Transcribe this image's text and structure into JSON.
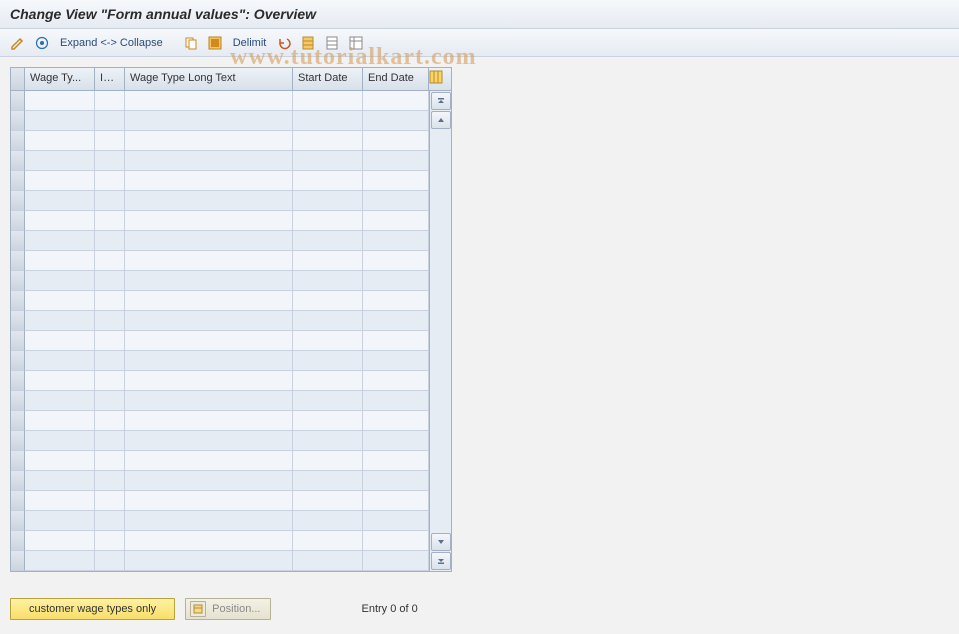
{
  "title": "Change View \"Form annual values\": Overview",
  "toolbar": {
    "expand_collapse": "Expand <-> Collapse",
    "delimit": "Delimit"
  },
  "columns": {
    "wage_type": "Wage Ty...",
    "inf": "Inf...",
    "long_text": "Wage Type Long Text",
    "start_date": "Start Date",
    "end_date": "End Date"
  },
  "rows": [
    {},
    {},
    {},
    {},
    {},
    {},
    {},
    {},
    {},
    {},
    {},
    {},
    {},
    {},
    {},
    {},
    {},
    {},
    {},
    {},
    {},
    {},
    {},
    {}
  ],
  "footer": {
    "customer_btn": "customer wage types only",
    "position_btn": "Position...",
    "entry_text": "Entry 0 of 0"
  },
  "watermark": "www.tutorialkart.com"
}
